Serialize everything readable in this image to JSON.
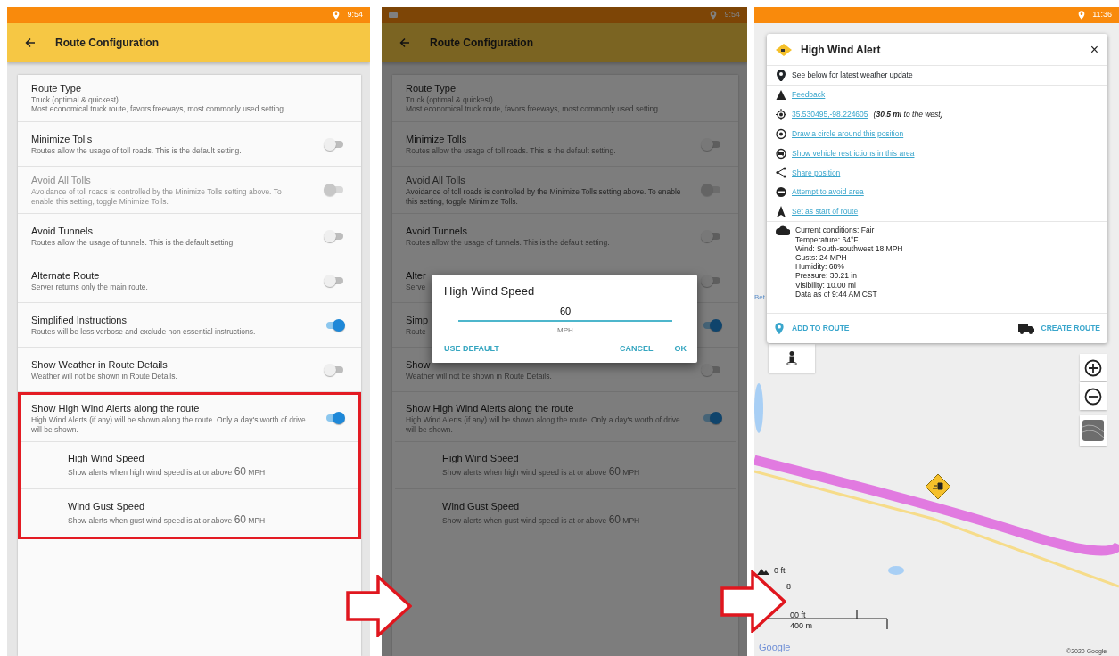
{
  "panels": [
    {
      "kind": "settings",
      "status_bar": {
        "time": "9:54"
      },
      "app_bar": {
        "title": "Route Configuration"
      },
      "rows": [
        {
          "kind": "choice",
          "title": "Route Type",
          "value": "Truck (optimal & quickest)",
          "subtitle": "Most economical truck route, favors freeways, most commonly used setting."
        },
        {
          "kind": "toggle",
          "title": "Minimize Tolls",
          "subtitle": "Routes allow the usage of toll roads. This is the default setting.",
          "on": false,
          "disabled": false
        },
        {
          "kind": "toggle",
          "title": "Avoid All Tolls",
          "subtitle": "Avoidance of toll roads is controlled by the Minimize Tolls setting above. To enable this setting, toggle Minimize Tolls.",
          "on": false,
          "disabled": true
        },
        {
          "kind": "toggle",
          "title": "Avoid Tunnels",
          "subtitle": "Routes allow the usage of tunnels. This is the default setting.",
          "on": false,
          "disabled": false
        },
        {
          "kind": "toggle",
          "title": "Alternate Route",
          "subtitle": "Server returns only the main route.",
          "on": false,
          "disabled": false
        },
        {
          "kind": "toggle",
          "title": "Simplified Instructions",
          "subtitle": "Routes will be less verbose and exclude non essential instructions.",
          "on": true,
          "disabled": false
        },
        {
          "kind": "toggle",
          "title": "Show Weather in Route Details",
          "subtitle": "Weather will not be shown in Route Details.",
          "on": false,
          "disabled": false
        },
        {
          "kind": "group",
          "highlighted": true,
          "title": "Show High Wind Alerts along the route",
          "subtitle": "High Wind Alerts (if any) will be shown along the route. Only a day's worth of drive will be shown.",
          "on": true,
          "disabled": false,
          "items": [
            {
              "title": "High Wind Speed",
              "subtitle": "Show alerts when high wind speed is at or above",
              "value": "60",
              "unit": "MPH"
            },
            {
              "title": "Wind Gust Speed",
              "subtitle": "Show alerts when gust wind speed is at or above",
              "value": "60",
              "unit": "MPH"
            }
          ]
        }
      ]
    },
    {
      "kind": "settings",
      "dimmed": true,
      "status_bar": {
        "time": "9:54",
        "notification_icon": true
      },
      "app_bar": {
        "title": "Route Configuration"
      },
      "rows": [
        {
          "kind": "choice",
          "title": "Route Type",
          "value": "Truck (optimal & quickest)",
          "subtitle": "Most economical truck route, favors freeways, most commonly used setting."
        },
        {
          "kind": "toggle",
          "title": "Minimize Tolls",
          "subtitle": "Routes allow the usage of toll roads. This is the default setting.",
          "on": false,
          "disabled": false
        },
        {
          "kind": "toggle",
          "title": "Avoid All Tolls",
          "subtitle": "Avoidance of toll roads is controlled by the Minimize Tolls setting above. To enable this setting, toggle Minimize Tolls.",
          "on": false,
          "disabled": true
        },
        {
          "kind": "toggle",
          "title": "Avoid Tunnels",
          "subtitle": "Routes allow the usage of tunnels. This is the default setting.",
          "on": false,
          "disabled": false
        },
        {
          "kind": "toggle",
          "title": "Alter",
          "subtitle": "Serve",
          "on": false,
          "disabled": false
        },
        {
          "kind": "toggle",
          "title": "Simp",
          "subtitle": "Route",
          "on": true,
          "disabled": false
        },
        {
          "kind": "toggle",
          "title": "Show",
          "subtitle": "Weather will not be shown in Route Details.",
          "on": false,
          "disabled": false
        },
        {
          "kind": "group",
          "highlighted": false,
          "title": "Show High Wind Alerts along the route",
          "subtitle": "High Wind Alerts (if any) will be shown along the route. Only a day's worth of drive will be shown.",
          "on": true,
          "disabled": false,
          "items": [
            {
              "title": "High Wind Speed",
              "subtitle": "Show alerts when high wind speed is at or above",
              "value": "60",
              "unit": "MPH"
            },
            {
              "title": "Wind Gust Speed",
              "subtitle": "Show alerts when gust wind speed is at or above",
              "value": "60",
              "unit": "MPH"
            }
          ]
        }
      ],
      "dialog": {
        "title": "High Wind Speed",
        "value": "60",
        "unit": "MPH",
        "buttons": [
          "USE DEFAULT",
          "CANCEL",
          "OK"
        ]
      }
    },
    {
      "kind": "map",
      "status_bar": {
        "time": "11:36"
      },
      "popup": {
        "title": "High Wind Alert",
        "close": "×",
        "rows": [
          {
            "kind": "info",
            "text": "See below for latest weather update"
          },
          {
            "kind": "link",
            "text": "Feedback"
          },
          {
            "kind": "coords",
            "text": "35.530495,-98.224605",
            "note": "(**30.5 mi** to the west)"
          },
          {
            "kind": "link",
            "text": "Draw a circle around this position"
          },
          {
            "kind": "link",
            "text": "Show vehicle restrictions in this area"
          },
          {
            "kind": "link",
            "text": "Share position"
          },
          {
            "kind": "link",
            "text": "Attempt to avoid area"
          },
          {
            "kind": "link",
            "text": "Set as start of route"
          }
        ],
        "weather": [
          "Current conditions: Fair",
          "Temperature: 64°F",
          "Wind: South-southwest 18 MPH",
          "Gusts: 24 MPH",
          "Humidity: 68%",
          "Pressure: 30.21 in",
          "Visibility: 10.00 mi",
          "Data as of 9:44 AM CST"
        ],
        "actions": [
          "ADD TO ROUTE",
          "CREATE ROUTE"
        ]
      },
      "map": {
        "place_label": "Bet",
        "elevation": "0 ft",
        "elevation_2": "8",
        "scale_ft": "00 ft",
        "scale_m": "400 m",
        "logo": "Google",
        "copyright": "©2020 Google"
      }
    }
  ]
}
